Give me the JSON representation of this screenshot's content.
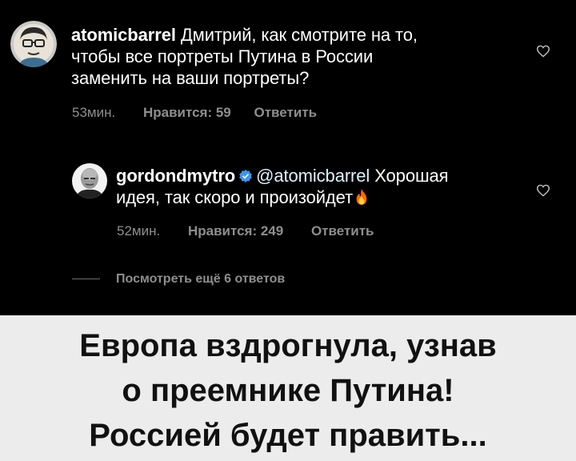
{
  "comments": [
    {
      "username": "atomicbarrel",
      "line1": "Дмитрий, как смотрите на то,",
      "line2": "чтобы все портреты Путина в России",
      "line3": "заменить на ваши портреты?",
      "time": "53мин.",
      "likes": "Нравится: 59",
      "reply": "Ответить",
      "avatar_icon": "glasses-avatar-icon"
    },
    {
      "username": "gordondmytro",
      "mention": "@atomicbarrel",
      "line1_rest": "Хорошая",
      "line2": "идея, так скоро и произойдет",
      "time": "52мин.",
      "likes": "Нравится: 249",
      "reply": "Ответить",
      "avatar_icon": "bald-man-avatar-icon"
    }
  ],
  "view_more": "Посмотреть ещё 6 ответов",
  "caption": {
    "line1": "Европа вздрогнула, узнав",
    "line2": "о преемнике Путина!",
    "line3": "Россией будет править..."
  },
  "colors": {
    "background": "#000000",
    "text": "#ffffff",
    "meta": "#8e8e8e",
    "verified": "#3897f0",
    "caption_bg": "#ececec"
  }
}
